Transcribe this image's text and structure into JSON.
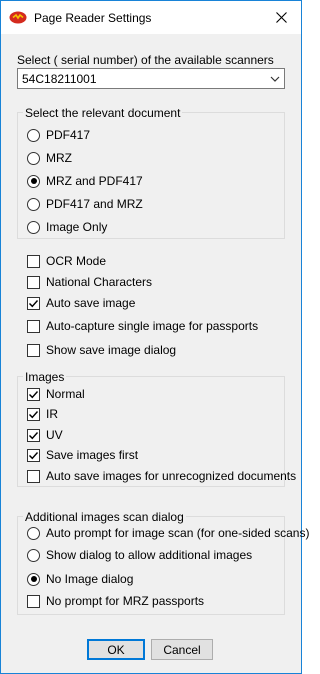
{
  "window": {
    "title": "Page Reader Settings",
    "close_glyph": "✕"
  },
  "scanner": {
    "label": "Select ( serial number) of  the available scanners",
    "selected": "54C18211001"
  },
  "document_group": {
    "label": "Select the relevant document",
    "options": [
      {
        "label": "PDF417",
        "selected": false
      },
      {
        "label": "MRZ",
        "selected": false
      },
      {
        "label": "MRZ and PDF417",
        "selected": true
      },
      {
        "label": "PDF417 and MRZ",
        "selected": false
      },
      {
        "label": "Image Only",
        "selected": false
      }
    ]
  },
  "general_options": [
    {
      "label": "OCR Mode",
      "checked": false
    },
    {
      "label": "National Characters",
      "checked": false
    },
    {
      "label": "Auto save image",
      "checked": true
    },
    {
      "label": "Auto-capture single image for passports",
      "checked": false
    },
    {
      "label": "Show save image dialog",
      "checked": false
    }
  ],
  "images_group": {
    "label": "Images",
    "options": [
      {
        "label": "Normal",
        "checked": true
      },
      {
        "label": "IR",
        "checked": true
      },
      {
        "label": "UV",
        "checked": true
      },
      {
        "label": "Save images first",
        "checked": true
      },
      {
        "label": "Auto save images for unrecognized documents",
        "checked": false
      }
    ]
  },
  "scan_dialog_group": {
    "label": "Additional images scan dialog",
    "radios": [
      {
        "label": "Auto prompt for image scan (for one-sided scans)",
        "selected": false
      },
      {
        "label": "Show dialog to allow additional images",
        "selected": false
      },
      {
        "label": "No Image dialog",
        "selected": true
      }
    ],
    "checkbox": {
      "label": "No prompt for MRZ passports",
      "checked": false
    }
  },
  "buttons": {
    "ok": "OK",
    "cancel": "Cancel"
  },
  "colors": {
    "window_border": "#1883d7",
    "dialog_bg": "#f0f0f0",
    "default_button_border": "#0078d7",
    "icon_red": "#d42b1e",
    "icon_yellow": "#f7c400"
  }
}
